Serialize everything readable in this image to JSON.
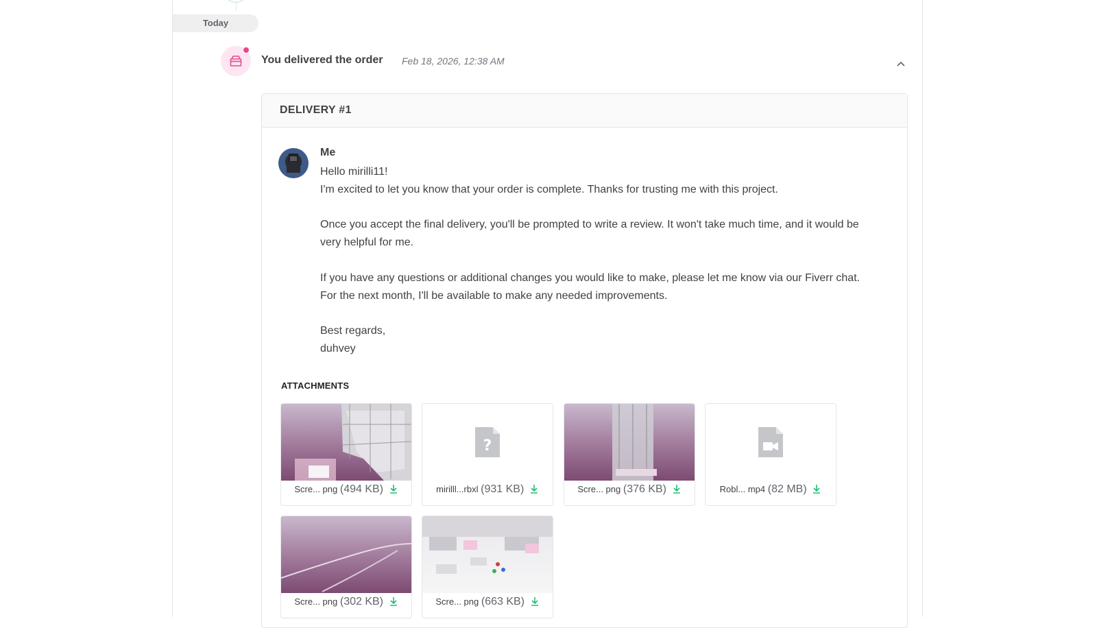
{
  "timeline": {
    "day_label": "Today"
  },
  "event": {
    "title": "You delivered the order",
    "date": "Feb 18, 2026, 12:38 AM",
    "icon": "package-icon"
  },
  "delivery": {
    "header": "DELIVERY #1",
    "sender": "Me",
    "message": [
      "Hello mirilli11!",
      "I'm excited to let you know that your order is complete. Thanks for trusting me with this project.",
      "",
      "Once you accept the final delivery, you'll be prompted to write a review. It won't take much time, and it would be very helpful for me.",
      "",
      "If you have any questions or additional changes you would like to make, please let me know via our Fiverr chat.",
      "For the next month, I'll be available to make any needed improvements.",
      "",
      "Best regards,",
      "duhvey"
    ],
    "attachments_label": "ATTACHMENTS",
    "attachments": [
      {
        "name": "Scre... png",
        "size": "(494 KB)",
        "kind": "image"
      },
      {
        "name": "mirilll...rbxl",
        "size": "(931 KB)",
        "kind": "unknown"
      },
      {
        "name": "Scre... png",
        "size": "(376 KB)",
        "kind": "image"
      },
      {
        "name": "Robl... mp4",
        "size": "(82 MB)",
        "kind": "video"
      },
      {
        "name": "Scre... png",
        "size": "(302 KB)",
        "kind": "image"
      },
      {
        "name": "Scre... png",
        "size": "(663 KB)",
        "kind": "image"
      }
    ]
  },
  "colors": {
    "accent_green": "#1dbf73",
    "icon_pink": "#e6488d",
    "icon_bg": "#fde6f2"
  }
}
